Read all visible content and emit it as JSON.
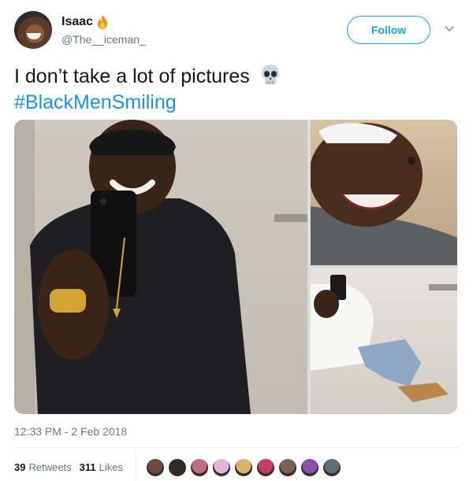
{
  "author": {
    "display_name": "Isaac",
    "handle": "@The__iceman_",
    "name_emoji_icon": "fire-icon"
  },
  "actions": {
    "follow_label": "Follow",
    "more_icon": "chevron-down-icon"
  },
  "tweet": {
    "text": "I don’t take a lot of pictures",
    "emoji_icon": "skull-icon",
    "hashtag": "#BlackMenSmiling",
    "timestamp": "12:33 PM - 2 Feb 2018"
  },
  "stats": {
    "retweets_count": "39",
    "retweets_label": "Retweets",
    "likes_count": "311",
    "likes_label": "Likes"
  },
  "likers": [
    {
      "color": "#6b4a3a"
    },
    {
      "color": "#2f2a2a"
    },
    {
      "color": "#c06b8a"
    },
    {
      "color": "#e0b6d8"
    },
    {
      "color": "#d9b36a"
    },
    {
      "color": "#c23b6a"
    },
    {
      "color": "#7a6152"
    },
    {
      "color": "#8c4fb0"
    },
    {
      "color": "#5a6f78"
    }
  ],
  "colors": {
    "accent": "#1da1f2",
    "hashtag": "#1b95e0",
    "secondary_text": "#657786"
  }
}
